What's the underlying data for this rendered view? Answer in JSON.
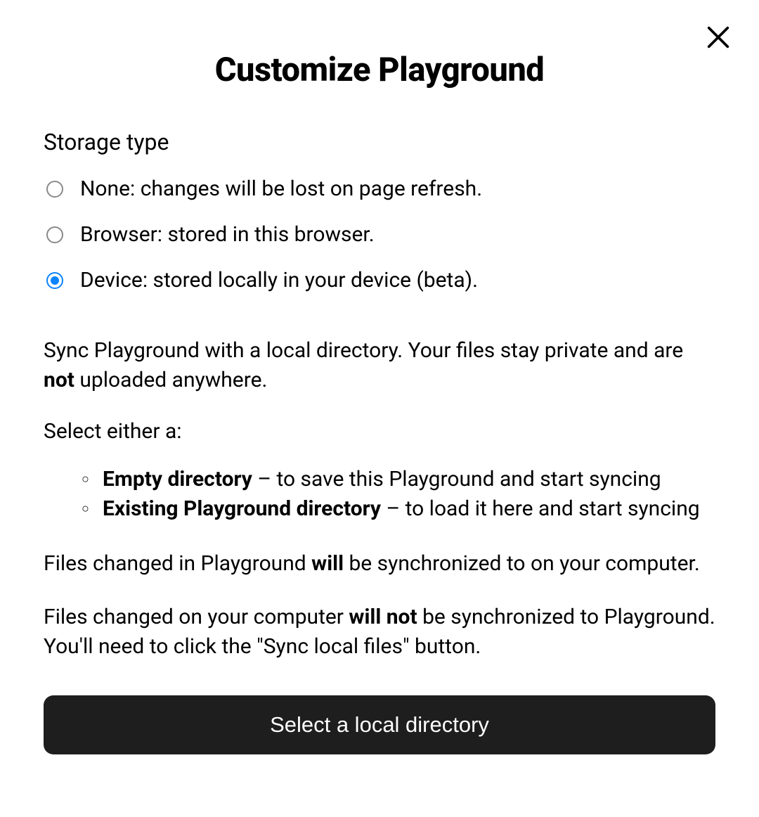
{
  "title": "Customize Playground",
  "section_title": "Storage type",
  "storage_options": [
    {
      "label": "None: changes will be lost on page refresh.",
      "selected": false
    },
    {
      "label": "Browser: stored in this browser.",
      "selected": false
    },
    {
      "label": "Device: stored locally in your device (beta).",
      "selected": true
    }
  ],
  "description": {
    "pre": "Sync Playground with a local directory. Your files stay private and are ",
    "bold": "not",
    "post": " uploaded anywhere."
  },
  "select_prompt": "Select either a:",
  "options": [
    {
      "bold": "Empty directory",
      "text": " – to save this Playground and start syncing"
    },
    {
      "bold": "Existing Playground directory",
      "text": " – to load it here and start syncing"
    }
  ],
  "sync_notes": [
    {
      "pre": "Files changed in Playground ",
      "bold": "will",
      "post": " be synchronized to on your computer."
    },
    {
      "pre": "Files changed on your computer ",
      "bold": "will not",
      "post": " be synchronized to Playground. You'll need to click the \"Sync local files\" button."
    }
  ],
  "button_label": "Select a local directory"
}
